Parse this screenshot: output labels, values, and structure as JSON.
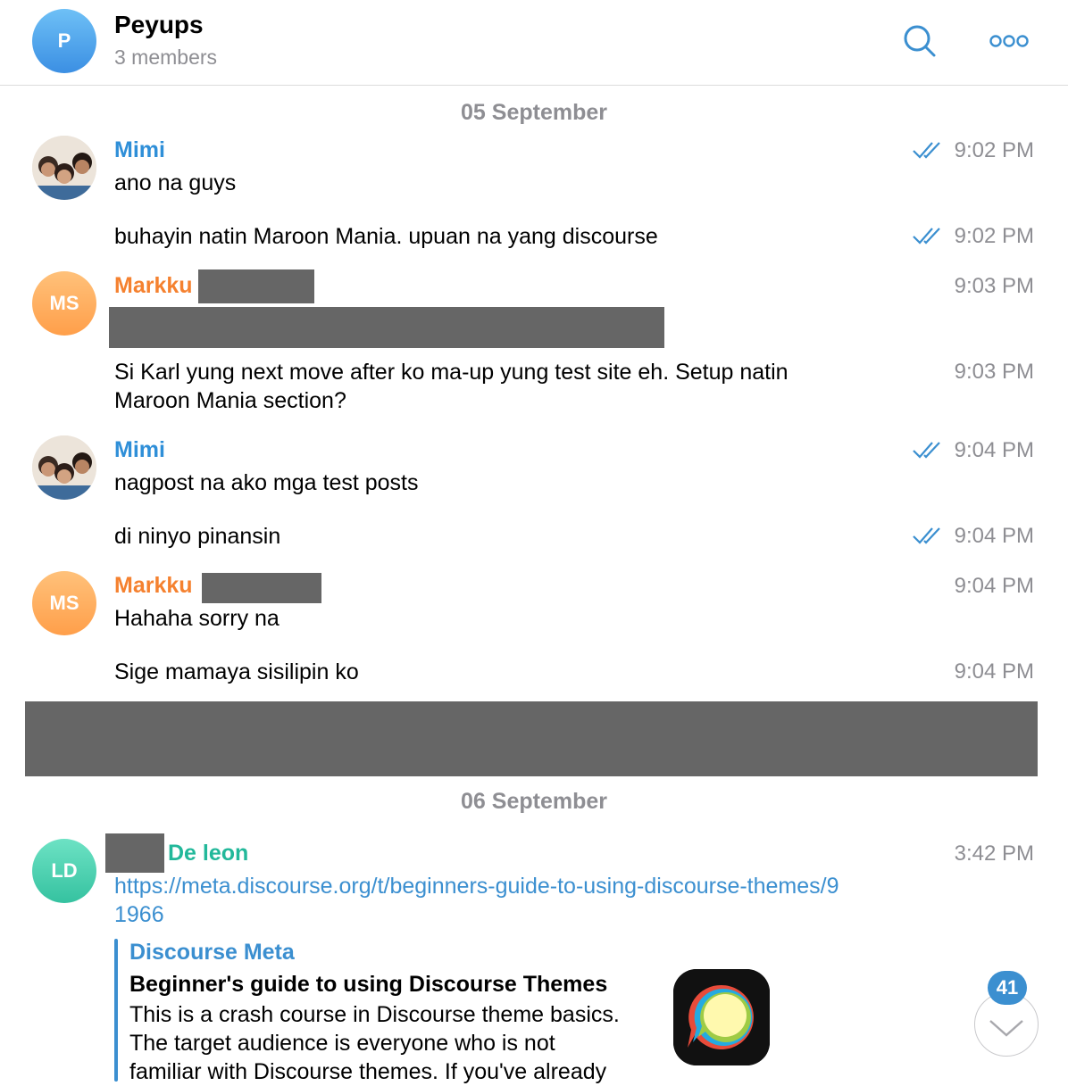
{
  "header": {
    "avatar_letter": "P",
    "title": "Peyups",
    "subtitle": "3 members",
    "search_icon": "search-icon",
    "more_icon": "more-icon"
  },
  "dates": [
    "05 September",
    "06 September"
  ],
  "messages": [
    {
      "sender": "Mimi",
      "text": "ano na guys",
      "time": "9:02 PM",
      "read": true
    },
    {
      "text": "buhayin natin Maroon Mania. upuan na yang discourse",
      "time": "9:02 PM",
      "read": true
    },
    {
      "avatar_initials": "MS",
      "sender": "Markku",
      "time": "9:03 PM"
    },
    {
      "text_line1": "Si Karl yung next move after ko ma-up yung test site eh. Setup natin",
      "text_line2": "Maroon Mania section?",
      "time": "9:03 PM"
    },
    {
      "sender": "Mimi",
      "text": "nagpost na ako mga test posts",
      "time": "9:04 PM",
      "read": true
    },
    {
      "text": "di ninyo pinansin",
      "time": "9:04 PM",
      "read": true
    },
    {
      "avatar_initials": "MS",
      "sender": "Markku",
      "text": "Hahaha sorry na",
      "time": "9:04 PM"
    },
    {
      "text": "Sige mamaya sisilipin ko",
      "time": "9:04 PM"
    },
    {
      "avatar_initials": "LD",
      "sender": "De leon",
      "link": "https://meta.discourse.org/t/beginners-guide-to-using-discourse-themes/91966",
      "time": "3:42 PM"
    }
  ],
  "preview": {
    "site": "Discourse Meta",
    "title": "Beginner's guide to using Discourse Themes",
    "desc_line1": "This is a crash course in Discourse theme basics.",
    "desc_line2": "The target audience is everyone who is not",
    "desc_line3": "familiar with Discourse themes. If you've already"
  },
  "scroll": {
    "unread_count": "41"
  },
  "colors": {
    "accent": "#3b8fd0",
    "sender_blue": "#2f8fd8",
    "sender_orange": "#f5812f",
    "sender_green": "#22b89a",
    "redaction": "#666666"
  }
}
